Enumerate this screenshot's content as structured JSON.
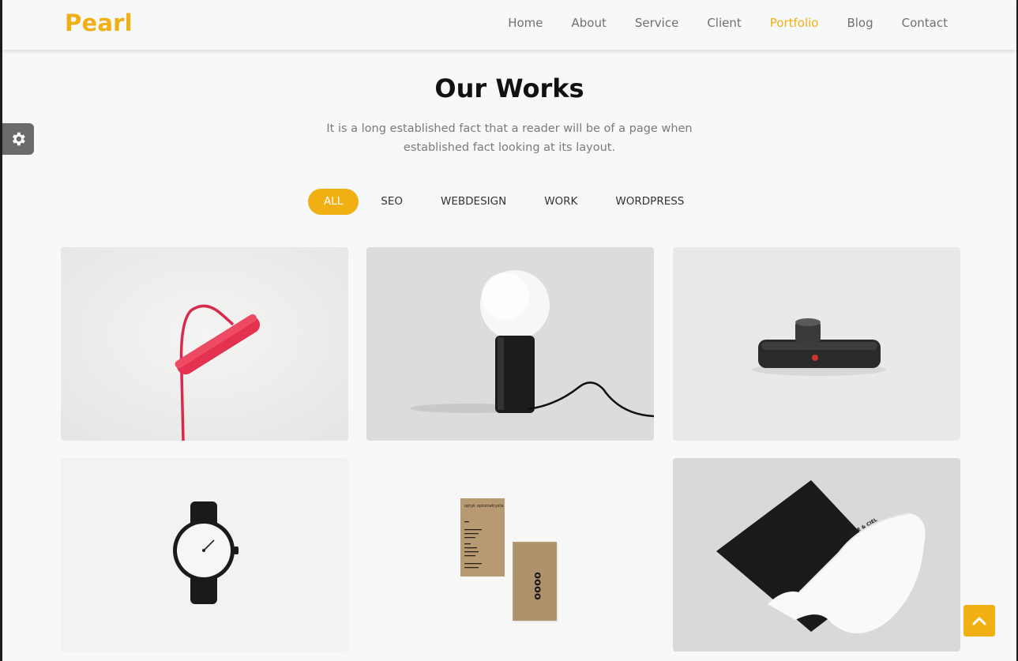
{
  "brand": {
    "name": "Pearl",
    "accent": "#f0b013"
  },
  "nav": {
    "items": [
      {
        "label": "Home"
      },
      {
        "label": "About"
      },
      {
        "label": "Service"
      },
      {
        "label": "Client"
      },
      {
        "label": "Portfolio",
        "active": true
      },
      {
        "label": "Blog"
      },
      {
        "label": "Contact"
      }
    ]
  },
  "settings": {
    "icon": "gear-icon"
  },
  "section": {
    "title_light": "Our",
    "title_bold": "Works",
    "subtitle_line1": "It is a long established fact that a reader will be of a page when",
    "subtitle_line2": "established fact looking at its layout."
  },
  "filters": [
    {
      "label": "ALL",
      "active": true
    },
    {
      "label": "SEO"
    },
    {
      "label": "WEBDESIGN"
    },
    {
      "label": "WORK"
    },
    {
      "label": "WORDPRESS"
    }
  ],
  "portfolio": {
    "items": [
      {
        "subject": "red-desk-lamp"
      },
      {
        "subject": "globe-table-lamp"
      },
      {
        "subject": "instant-camera"
      },
      {
        "subject": "wrist-watch"
      },
      {
        "subject": "business-cards",
        "card_text": "optyk optometrysta",
        "logo_text": "oooo"
      },
      {
        "subject": "envelope-stationery",
        "card_text": "COTE & CIEL"
      }
    ]
  },
  "back_to_top": {
    "icon": "chevron-up-icon"
  }
}
